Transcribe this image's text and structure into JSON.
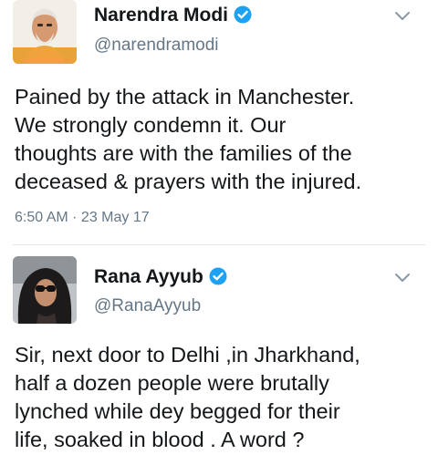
{
  "tweets": [
    {
      "name": "Narendra Modi",
      "handle": "@narendramodi",
      "text": "Pained by the attack in Manchester.\nWe strongly condemn it. Our\nthoughts are with the families of the\ndeceased & prayers with the injured.",
      "timestamp": "6:50 AM · 23 May 17",
      "verified": true,
      "avatar_icon": "user-avatar-modi"
    },
    {
      "name": "Rana Ayyub",
      "handle": "@RanaAyyub",
      "text": "Sir, next door to Delhi ,in Jharkhand,\nhalf a dozen people were brutally\nlynched while dey begged for their\nlife, soaked in blood . A word ?",
      "verified": true,
      "avatar_icon": "user-avatar-ayyub"
    }
  ],
  "colors": {
    "verified_blue": "#1da1f2",
    "secondary_text": "#657786",
    "primary_text": "#14171a",
    "divider": "#e1e8ed"
  }
}
